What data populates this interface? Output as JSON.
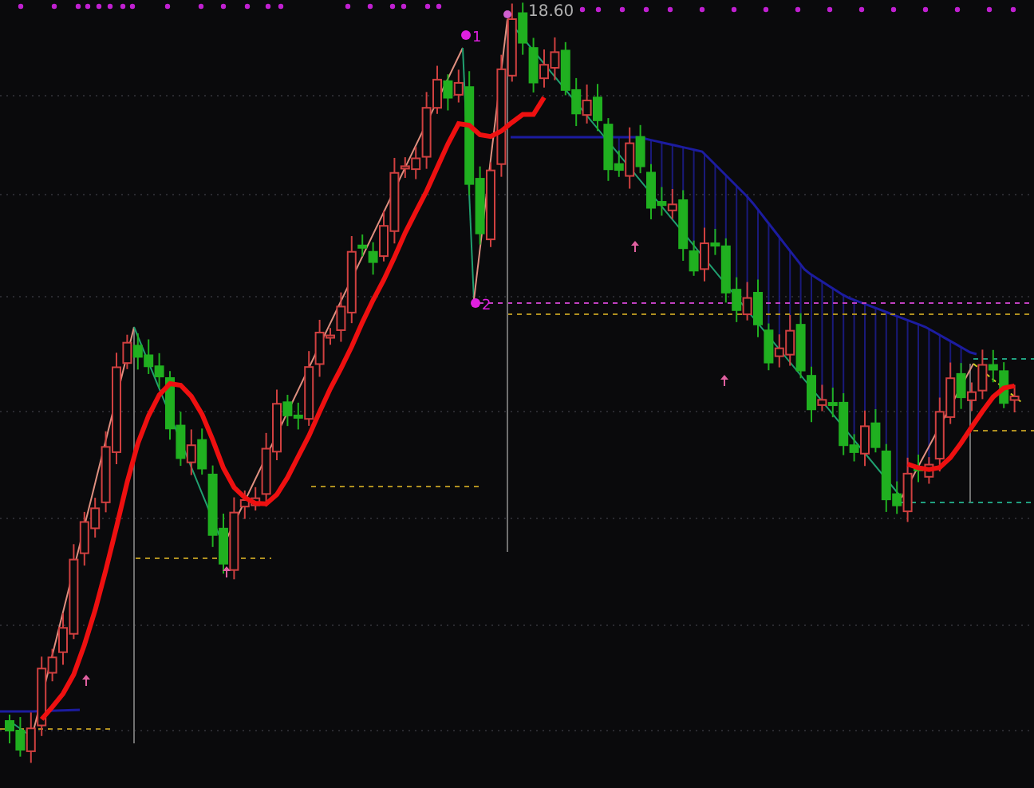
{
  "chart": {
    "price_label": "18.60",
    "pivot_labels": [
      "1",
      "2"
    ]
  }
}
